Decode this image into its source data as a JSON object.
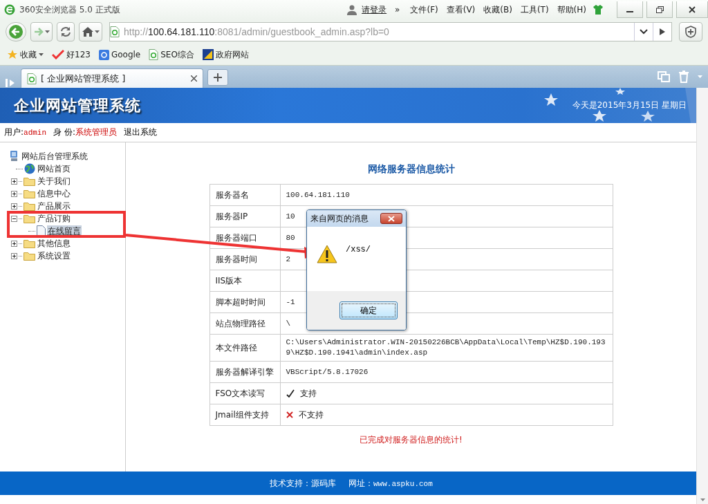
{
  "browser": {
    "title": "360安全浏览器 5.0 正式版",
    "login": "请登录",
    "more": "»",
    "menu": [
      "文件(F)",
      "查看(V)",
      "收藏(B)",
      "工具(T)",
      "帮助(H)"
    ],
    "address": {
      "scheme": "http://",
      "host": "100.64.181.110",
      "path": ":8081/admin/guestbook_admin.asp?lb=0"
    },
    "bookmarks": [
      {
        "label": "收藏",
        "kind": "favorites"
      },
      {
        "label": "好123",
        "kind": "hao"
      },
      {
        "label": "Google",
        "kind": "google"
      },
      {
        "label": "SEO综合",
        "kind": "ie"
      },
      {
        "label": "政府网站",
        "kind": "gov"
      }
    ],
    "tabs": [
      {
        "label": "[ 企业网站管理系统 ]",
        "selected": true
      }
    ]
  },
  "site": {
    "title": "企业网站管理系统",
    "date": "今天是2015年3月15日 星期日",
    "user_label": "用户:",
    "user": "admin",
    "role_label": "身 份:",
    "role": "系统管理员",
    "logout": "退出系统"
  },
  "tree": {
    "label": "网站后台管理系统",
    "kind": "computer",
    "selected": false,
    "children": [
      {
        "label": "网站首页",
        "kind": "globe",
        "selected": false
      },
      {
        "label": "关于我们",
        "kind": "folder",
        "expanded": false,
        "selected": false
      },
      {
        "label": "信息中心",
        "kind": "folder",
        "expanded": false,
        "selected": false
      },
      {
        "label": "产品展示",
        "kind": "folder",
        "expanded": false,
        "selected": false
      },
      {
        "label": "产品订购",
        "kind": "folder",
        "expanded": true,
        "selected": false,
        "children": [
          {
            "label": "在线留言",
            "kind": "page",
            "selected": true
          }
        ]
      },
      {
        "label": "其他信息",
        "kind": "folder",
        "expanded": false,
        "selected": false
      },
      {
        "label": "系统设置",
        "kind": "folder",
        "expanded": false,
        "selected": false
      }
    ]
  },
  "info": {
    "heading": "网络服务器信息统计",
    "rows": [
      {
        "label": "服务器名",
        "kind": "text",
        "value": "100.64.181.110"
      },
      {
        "label": "服务器IP",
        "kind": "text",
        "value": "10"
      },
      {
        "label": "服务器端口",
        "kind": "text",
        "value": "80"
      },
      {
        "label": "服务器时间",
        "kind": "text",
        "value": "2"
      },
      {
        "label": "IIS版本",
        "kind": "text"
      },
      {
        "label": "脚本超时时间",
        "kind": "text",
        "value": "-1"
      },
      {
        "label": "站点物理路径",
        "kind": "text",
        "value": "\\"
      },
      {
        "label": "本文件路径",
        "kind": "text",
        "value": "C:\\Users\\Administrator.WIN-20150226BCB\\AppData\\Local\\Temp\\HZ$D.190.1939\\HZ$D.190.1941\\admin\\index.asp"
      },
      {
        "label": "服务器解译引擎",
        "kind": "text",
        "value": "VBScript/5.8.17026"
      },
      {
        "label": "FSO文本读写",
        "kind": "support",
        "supported": true,
        "value": "支持"
      },
      {
        "label": "Jmail组件支持",
        "kind": "support",
        "supported": false,
        "value": "不支持"
      }
    ],
    "status": "已完成对服务器信息的统计!"
  },
  "footer": {
    "support": "技术支持：源码库",
    "site_label": "网址：",
    "site": "www.aspku.com"
  },
  "dialog": {
    "title": "来自网页的消息",
    "message": "/xss/",
    "button": "确定"
  }
}
